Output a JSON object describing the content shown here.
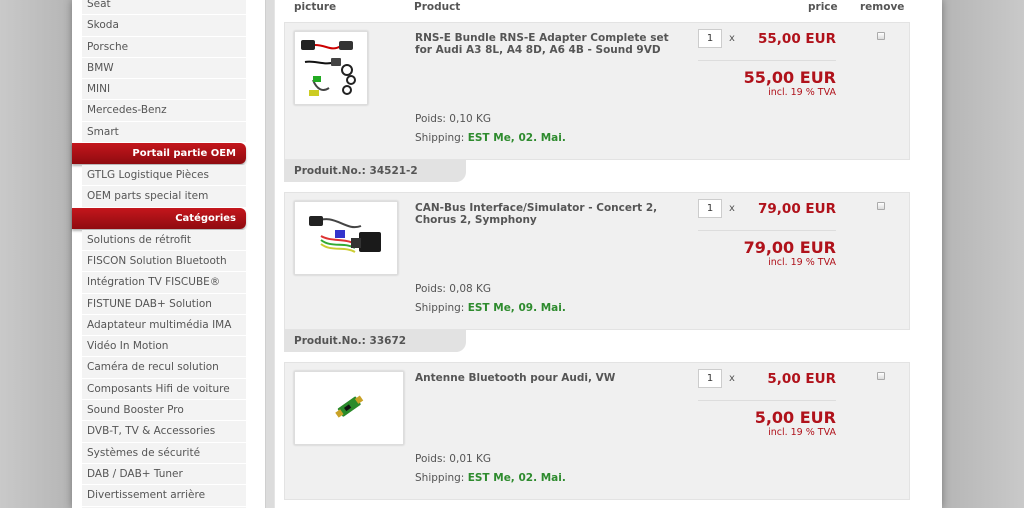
{
  "sidebar": {
    "brands": [
      "Seat",
      "Skoda",
      "Porsche",
      "BMW",
      "MINI",
      "Mercedes-Benz",
      "Smart"
    ],
    "oem_header": "Portail partie OEM",
    "oem_items": [
      "GTLG Logistique Pièces",
      "OEM parts special item"
    ],
    "categories_header": "Catégories",
    "categories": [
      "Solutions de rétrofit",
      "FISCON Solution Bluetooth",
      "Intégration TV FISCUBE®",
      "FISTUNE DAB+ Solution",
      "Adaptateur multimédia IMA",
      "Vidéo In Motion",
      "Caméra de recul solution",
      "Composants Hifi de voiture",
      "Sound Booster Pro",
      "DVB-T, TV & Accessories",
      "Systèmes de sécurité",
      "DAB / DAB+ Tuner",
      "Divertissement arrière"
    ]
  },
  "cart": {
    "columns": {
      "picture": "picture",
      "product": "Product",
      "price": "price",
      "remove": "remove"
    },
    "items": [
      {
        "name": "RNS-E Bundle RNS-E Adapter Complete set for Audi A3 8L, A4 8D, A6 4B - Sound 9VD",
        "qty": "1",
        "times": "x",
        "unit_price": "55,00 EUR",
        "total_price": "55,00 EUR",
        "vat": "incl. 19 % TVA",
        "weight": "Poids: 0,10 KG",
        "shipping_label": "Shipping:",
        "shipping_date": "EST Me, 02. Mai.",
        "product_no": "Produit.No.: 34521-2",
        "image_icon": "cable-set-icon"
      },
      {
        "name": "CAN-Bus Interface/Simulator - Concert 2, Chorus 2, Symphony",
        "qty": "1",
        "times": "x",
        "unit_price": "79,00 EUR",
        "total_price": "79,00 EUR",
        "vat": "incl. 19 % TVA",
        "weight": "Poids: 0,08 KG",
        "shipping_label": "Shipping:",
        "shipping_date": "EST Me, 09. Mai.",
        "product_no": "Produit.No.: 33672",
        "image_icon": "can-bus-module-icon"
      },
      {
        "name": "Antenne Bluetooth pour Audi, VW",
        "qty": "1",
        "times": "x",
        "unit_price": "5,00 EUR",
        "total_price": "5,00 EUR",
        "vat": "incl. 19 % TVA",
        "weight": "Poids: 0,01 KG",
        "shipping_label": "Shipping:",
        "shipping_date": "EST Me, 02. Mai.",
        "image_icon": "bluetooth-antenna-icon"
      }
    ]
  },
  "colors": {
    "accent_red": "#b0121b",
    "shipping_green": "#2e8b2e",
    "header_red": "#c4161c"
  }
}
